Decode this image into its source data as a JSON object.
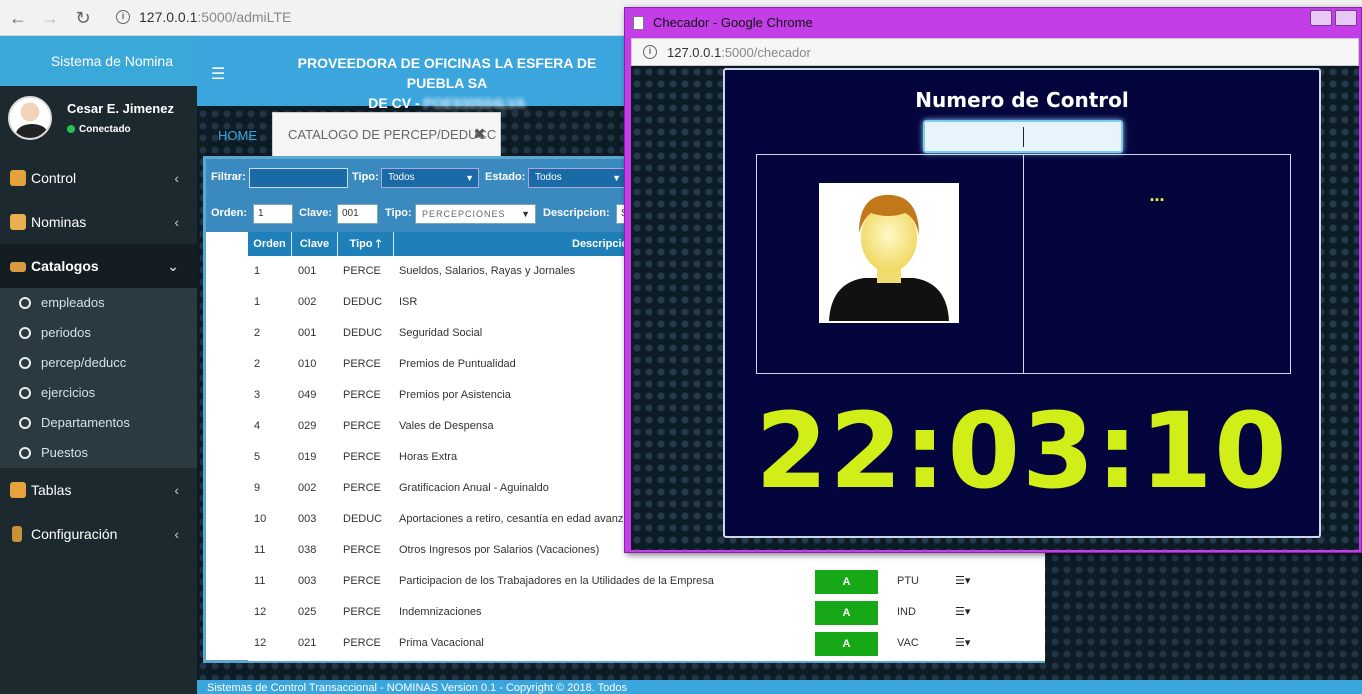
{
  "browser": {
    "url_host": "127.0.0.1",
    "url_port_path": ":5000/admiLTE"
  },
  "sidebar": {
    "app_title": "Sistema de Nomina",
    "user_name": "Cesar E. Jimenez",
    "user_status": "Conectado",
    "menu": [
      {
        "label": "Control"
      },
      {
        "label": "Nominas"
      },
      {
        "label": "Catalogos"
      },
      {
        "label": "Tablas"
      },
      {
        "label": "Configuración"
      }
    ],
    "submenu": [
      {
        "label": "empleados"
      },
      {
        "label": "periodos"
      },
      {
        "label": "percep/deducc"
      },
      {
        "label": "ejercicios"
      },
      {
        "label": "Departamentos"
      },
      {
        "label": "Puestos"
      }
    ]
  },
  "header": {
    "company_line1": "PROVEEDORA DE OFICINAS LA ESFERA DE PUEBLA SA",
    "company_line2": "DE CV -",
    "rfc_blurred": "POE930504LVA"
  },
  "tabs": {
    "home": "HOME",
    "active": "CATALOGO DE PERCEP/DEDUCC"
  },
  "filters": {
    "filtrar_label": "Filtrar:",
    "tipo_label": "Tipo:",
    "tipo_value": "Todos",
    "estado_label": "Estado:",
    "estado_value": "Todos",
    "orden_label": "Orden:",
    "orden_value": "1",
    "clave_label": "Clave:",
    "clave_value": "001",
    "tipo2_label": "Tipo:",
    "tipo2_value": "PERCEPCIONES",
    "descripcion_label": "Descripcion:",
    "descripcion_value": "S"
  },
  "table": {
    "headers": [
      "Orden",
      "Clave",
      "Tipo",
      "Descripcion"
    ],
    "rows": [
      {
        "orden": "1",
        "clave": "001",
        "tipo": "PERCE",
        "desc": "Sueldos, Salarios, Rayas y Jornales",
        "estado": "",
        "abrev": ""
      },
      {
        "orden": "1",
        "clave": "002",
        "tipo": "DEDUC",
        "desc": "ISR",
        "estado": "",
        "abrev": ""
      },
      {
        "orden": "2",
        "clave": "001",
        "tipo": "DEDUC",
        "desc": "Seguridad Social",
        "estado": "",
        "abrev": ""
      },
      {
        "orden": "2",
        "clave": "010",
        "tipo": "PERCE",
        "desc": "Premios de Puntualidad",
        "estado": "",
        "abrev": ""
      },
      {
        "orden": "3",
        "clave": "049",
        "tipo": "PERCE",
        "desc": "Premios por Asistencia",
        "estado": "",
        "abrev": ""
      },
      {
        "orden": "4",
        "clave": "029",
        "tipo": "PERCE",
        "desc": "Vales de Despensa",
        "estado": "",
        "abrev": ""
      },
      {
        "orden": "5",
        "clave": "019",
        "tipo": "PERCE",
        "desc": "Horas Extra",
        "estado": "",
        "abrev": ""
      },
      {
        "orden": "9",
        "clave": "002",
        "tipo": "PERCE",
        "desc": "Gratificacion Anual - Aguinaldo",
        "estado": "",
        "abrev": ""
      },
      {
        "orden": "10",
        "clave": "003",
        "tipo": "DEDUC",
        "desc": "Aportaciones a retiro, cesantía en edad avanz",
        "estado": "",
        "abrev": ""
      },
      {
        "orden": "11",
        "clave": "038",
        "tipo": "PERCE",
        "desc": "Otros Ingresos por Salarios (Vacaciones)",
        "estado": "",
        "abrev": ""
      },
      {
        "orden": "11",
        "clave": "003",
        "tipo": "PERCE",
        "desc": "Participacion de los Trabajadores en la Utilidades de la Empresa",
        "estado": "A",
        "abrev": "PTU"
      },
      {
        "orden": "12",
        "clave": "025",
        "tipo": "PERCE",
        "desc": "Indemnizaciones",
        "estado": "A",
        "abrev": "IND"
      },
      {
        "orden": "12",
        "clave": "021",
        "tipo": "PERCE",
        "desc": "Prima Vacacional",
        "estado": "A",
        "abrev": "VAC"
      }
    ]
  },
  "footer": {
    "text": "Sistemas de Control Transaccional - NOMINAS Version 0.1 - Copyright © 2018. Todos"
  },
  "popup": {
    "title": "Checador - Google Chrome",
    "url_host": "127.0.0.1",
    "url_port_path": ":5000/checador",
    "heading": "Numero de Control",
    "input_value": "",
    "employee_name": "...",
    "clock": "22:03:10"
  },
  "colors": {
    "clock": "#d2ee19",
    "popup_frame": "#c33ee7",
    "header_blue": "#3ba6dd",
    "badge_green": "#16a816"
  },
  "icons": [
    "back-arrow-icon",
    "forward-arrow-icon",
    "reload-icon",
    "info-icon",
    "hamburger-icon",
    "close-icon",
    "chevron-left-icon",
    "chevron-down-icon",
    "circle-icon",
    "sort-up-icon",
    "list-menu-icon",
    "user-photo"
  ]
}
